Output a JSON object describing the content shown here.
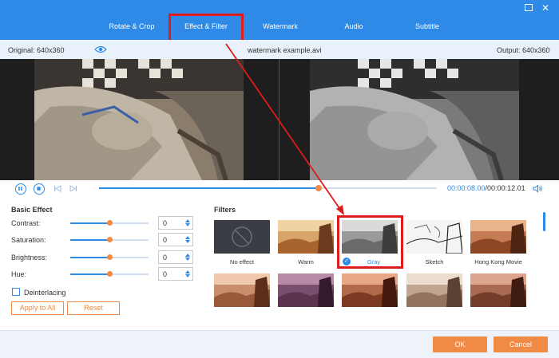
{
  "tabs": [
    {
      "label": "Rotate & Crop"
    },
    {
      "label": "Effect & Filter"
    },
    {
      "label": "Watermark"
    },
    {
      "label": "Audio"
    },
    {
      "label": "Subtitle"
    }
  ],
  "active_tab": "Effect & Filter",
  "info": {
    "original": "Original: 640x360",
    "filename": "watermark example.avi",
    "output": "Output: 640x360"
  },
  "playback": {
    "current": "00:00:08.00",
    "total": "/00:00:12.01",
    "progress": 0.65
  },
  "basic_effect": {
    "title": "Basic Effect",
    "sliders": [
      {
        "label": "Contrast:",
        "value": "0",
        "position": 0.5
      },
      {
        "label": "Saturation:",
        "value": "0",
        "position": 0.5
      },
      {
        "label": "Brightness:",
        "value": "0",
        "position": 0.5
      },
      {
        "label": "Hue:",
        "value": "0",
        "position": 0.5
      }
    ],
    "deinterlacing": "Deinterlacing",
    "apply_all": "Apply to All",
    "reset": "Reset"
  },
  "filters": {
    "title": "Filters",
    "items": [
      {
        "label": "No effect"
      },
      {
        "label": "Warm"
      },
      {
        "label": "Gray",
        "selected": true
      },
      {
        "label": "Sketch"
      },
      {
        "label": "Hong Kong Movie"
      }
    ]
  },
  "footer": {
    "ok": "OK",
    "cancel": "Cancel"
  },
  "colors": {
    "brand_blue": "#2e8ae6",
    "accent_orange": "#f08a45",
    "annotation_red": "#e01b1b"
  }
}
